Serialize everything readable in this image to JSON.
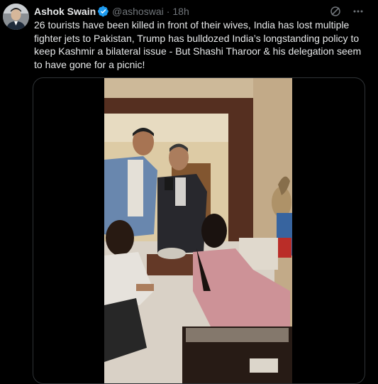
{
  "tweet": {
    "author_name": "Ashok Swain",
    "handle": "@ashoswai",
    "separator": "·",
    "time": "18h",
    "text": "26 tourists have been killed in front of their wives, India has lost multiple fighter jets to Pakistan, Trump has bulldozed India’s longstanding policy to keep Kashmir a bilateral issue - But Shashi Tharoor & his delegation seem to have gone for a picnic!"
  },
  "icons": {
    "verified": "verified-badge-icon",
    "grok": "grok-icon",
    "more": "more-options-icon"
  },
  "colors": {
    "background": "#000000",
    "text": "#e7e9ea",
    "secondary": "#71767b",
    "verified": "#1d9bf0"
  }
}
